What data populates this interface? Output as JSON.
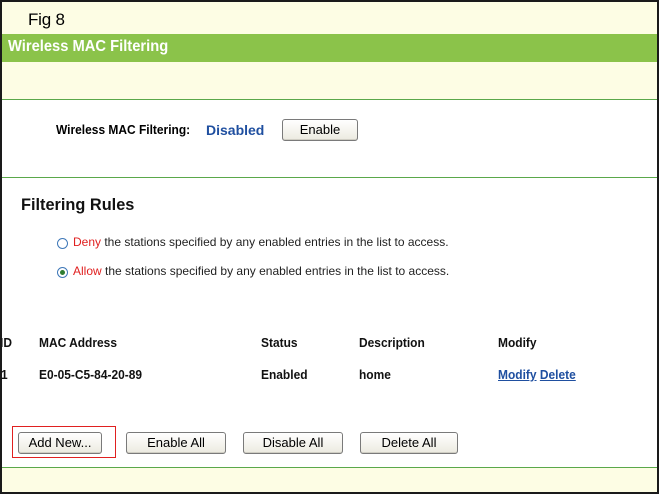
{
  "figure_label": "Fig 8",
  "page_title": "Wireless MAC Filtering",
  "status": {
    "label": "Wireless MAC Filtering:",
    "value": "Disabled",
    "enable_button": "Enable"
  },
  "filtering_rules": {
    "title": "Filtering Rules",
    "options": [
      {
        "key": "Deny",
        "text": " the stations specified by any enabled entries in the list to access.",
        "selected": false
      },
      {
        "key": "Allow",
        "text": " the stations specified by any enabled entries in the list to access.",
        "selected": true
      }
    ]
  },
  "table": {
    "headers": {
      "id": "ID",
      "mac": "MAC Address",
      "status": "Status",
      "description": "Description",
      "modify": "Modify"
    },
    "rows": [
      {
        "id": "1",
        "mac": "E0-05-C5-84-20-89",
        "status": "Enabled",
        "description": "home",
        "modify_label": "Modify",
        "delete_label": "Delete"
      }
    ]
  },
  "buttons": {
    "add_new": "Add New...",
    "enable_all": "Enable All",
    "disable_all": "Disable All",
    "delete_all": "Delete All"
  },
  "colors": {
    "title_bar": "#8bc34a",
    "status_value": "#1f4fa0",
    "rule_key": "#e02020",
    "highlight": "#e02020"
  }
}
